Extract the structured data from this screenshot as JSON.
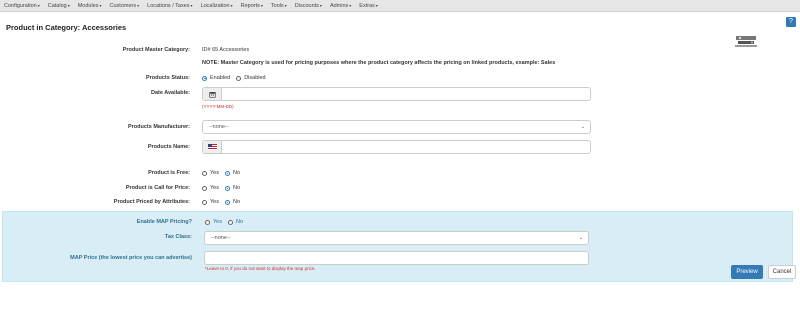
{
  "nav": {
    "items": [
      "Configuration",
      "Catalog",
      "Modules",
      "Customers",
      "Locations / Taxes",
      "Localization",
      "Reports",
      "Tools",
      "Discounts",
      "Admins",
      "Extras"
    ]
  },
  "help_label": "?",
  "page_title": "Product in Category: Accessories",
  "form": {
    "master_category": {
      "label": "Product Master Category:",
      "value": "ID# 65 Accessories",
      "note": "NOTE: Master Category is used for pricing purposes where the product category affects the pricing on linked products, example: Sales"
    },
    "status": {
      "label": "Products Status:",
      "options": [
        "Enabled",
        "Disabled"
      ],
      "selected": "Enabled"
    },
    "date_available": {
      "label": "Date Available:",
      "value": "",
      "hint": "(YYYY-MM-DD)"
    },
    "manufacturer": {
      "label": "Products Manufacturer:",
      "selected": "--none--"
    },
    "name": {
      "label": "Products Name:",
      "value": ""
    },
    "is_free": {
      "label": "Product is Free:",
      "options": [
        "Yes",
        "No"
      ],
      "selected": "No"
    },
    "call_for_price": {
      "label": "Product is Call for Price:",
      "options": [
        "Yes",
        "No"
      ],
      "selected": "No"
    },
    "priced_by_attributes": {
      "label": "Product Priced by Attributes:",
      "options": [
        "Yes",
        "No"
      ],
      "selected": "No"
    }
  },
  "map": {
    "enable": {
      "label": "Enable MAP Pricing?",
      "options": [
        "Yes",
        "No"
      ],
      "selected": null
    },
    "tax_class": {
      "label": "Tax Class:",
      "selected": "--none--"
    },
    "map_price": {
      "label": "MAP Price (the lowest price you can advertise)",
      "value": "",
      "hint": "*Leave to 0, if you do not want to display the map price."
    }
  },
  "buttons": {
    "preview": "Preview",
    "cancel": "Cancel"
  },
  "colors": {
    "primary": "#337ab7",
    "map_panel_bg": "#d9edf7",
    "hint_red": "#c9302c",
    "nav_bg": "#e6e6e6"
  }
}
